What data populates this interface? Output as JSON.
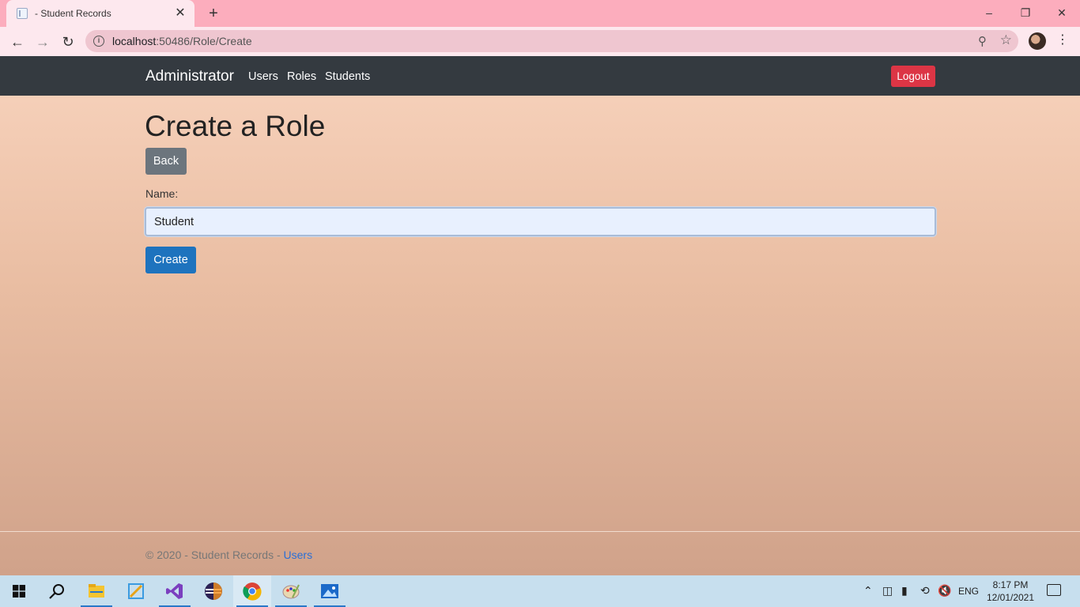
{
  "browser": {
    "tab_title": "- Student Records",
    "tab_close": "✕",
    "new_tab": "+",
    "url_host": "localhost",
    "url_path": ":50486/Role/Create"
  },
  "app": {
    "brand": "Administrator",
    "nav": [
      "Users",
      "Roles",
      "Students"
    ],
    "logout_label": "Logout",
    "page_title": "Create a Role",
    "back_label": "Back",
    "name_label": "Name:",
    "name_value": "Student",
    "create_label": "Create",
    "footer_text": "© 2020 - Student Records - ",
    "footer_link": "Users"
  },
  "taskbar": {
    "lang": "ENG",
    "time": "8:17 PM",
    "date": "12/01/2021"
  },
  "colors": {
    "navbar": "#343a40",
    "logout": "#dc3545",
    "back": "#6c757d",
    "create": "#1e73be",
    "tab_bar": "#fcadbd"
  }
}
